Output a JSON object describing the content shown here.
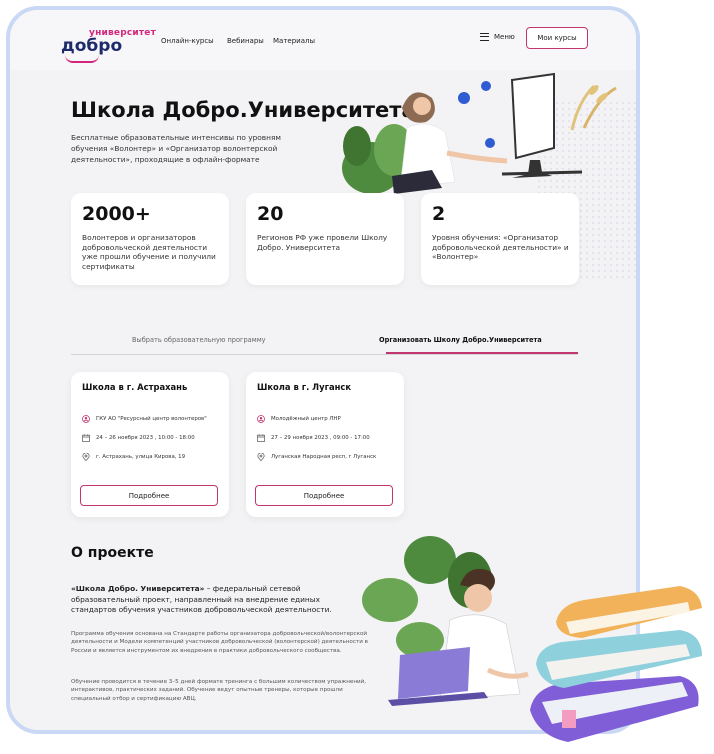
{
  "logo": {
    "sup": "университет",
    "main": "добро"
  },
  "nav": {
    "items": [
      "Онлайн-курсы",
      "Вебинары",
      "Материалы"
    ]
  },
  "header": {
    "menu_label": "Меню",
    "my_courses_label": "Мои курсы"
  },
  "hero": {
    "title": "Школа Добро.Университета",
    "description": "Бесплатные образовательные интенсивы по уровням обучения «Волонтер» и «Организатор волонтерской деятельности», проходящие в офлайн-формате"
  },
  "stats": [
    {
      "value": "2000+",
      "text": "Волонтеров и организаторов добровольческой деятельности уже прошли обучение и получили сертификаты"
    },
    {
      "value": "20",
      "text": "Регионов РФ уже провели Школу Добро. Университета"
    },
    {
      "value": "2",
      "text": "Уровня обучения: «Организатор добровольческой деятельности» и «Волонтер»"
    }
  ],
  "tabs": {
    "first": "Выбрать образовательную программу",
    "second": "Организовать Школу Добро.Университета"
  },
  "schools": [
    {
      "title": "Школа в г. Астрахань",
      "org": "ГКУ АО \"Ресурсный центр волонтеров\"",
      "dates": "24 – 26 ноября 2023 , 10:00 - 18:00",
      "address": "г. Астрахань, улица Кирова, 19",
      "more": "Подробнее"
    },
    {
      "title": "Школа в г. Луганск",
      "org": "Молодёжный центр ЛНР",
      "dates": "27 – 29 ноября 2023 , 09:00 - 17:00",
      "address": "Луганская Народная респ, г Луганск",
      "more": "Подробнее"
    }
  ],
  "about": {
    "title": "О проекте",
    "lead_bold": "«Школа Добро. Университета»",
    "lead_rest": " – федеральный сетевой образовательный проект, направленный на внедрение единых стандартов обучения участников добровольческой деятельности.",
    "p1": "Программа обучения основана на Стандарте работы организатора добровольческой/волонтерской деятельности и Модели компетенций участников добровольческой (волонтерской) деятельности в России и является инструментом их внедрения в практики добровольческого сообщества.",
    "p2": "Обучение проводится в течение 3–5 дней формате тренинга с большим количеством упражнений, интерактивов, практических заданий. Обучение ведут опытные тренеры, которые прошли специальный отбор и сертификацию АВЦ."
  },
  "colors": {
    "accent": "#c23670",
    "brand": "#1d2b6b",
    "frame": "#c9d8f5"
  },
  "icons": [
    "menu-icon",
    "person-icon",
    "calendar-icon",
    "location-icon"
  ]
}
